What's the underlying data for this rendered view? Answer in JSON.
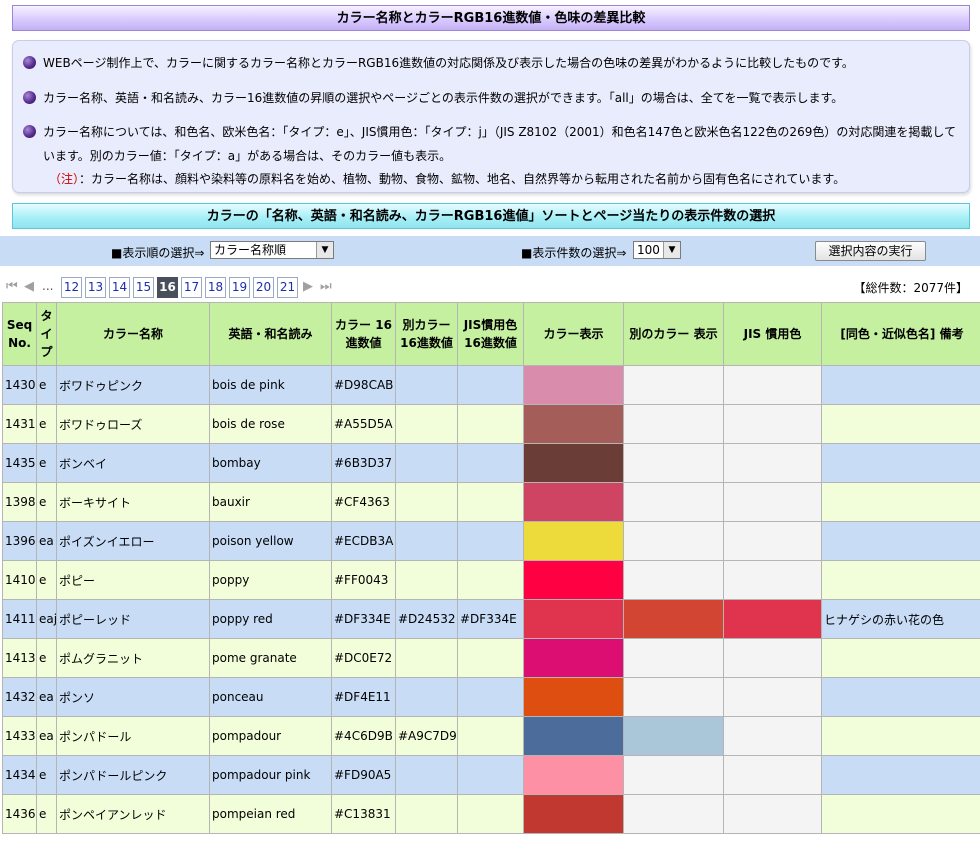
{
  "title": "カラー名称とカラーRGB16進数値・色味の差異比較",
  "info": {
    "line1": "WEBページ制作上で、カラーに関するカラー名称とカラーRGB16進数値の対応関係及び表示した場合の色味の差異がわかるように比較したものです。",
    "line2": "カラー名称、英語・和名読み、カラー16進数値の昇順の選択やページごとの表示件数の選択ができます。「all」の場合は、全てを一覧で表示します。",
    "line3a": "カラー名称については、和色名、欧米色名：「タイプ：e」、JIS慣用色：「タイプ：j」（JIS Z8102（2001）和色名147色と欧米色名122色の269色）の対応関連を掲載して",
    "line3b": "います。別のカラー値：「タイプ：a」がある場合は、そのカラー値も表示。",
    "note_mark": "（注）",
    "note_text": "：カラー名称は、顔料や染料等の原料名を始め、植物、動物、食物、鉱物、地名、自然界等から転用された名前から固有色名にされています。"
  },
  "subtitle": "カラーの「名称、英語・和名読み、カラーRGB16進値」ソートとページ当たりの表示件数の選択",
  "controls": {
    "order_label": "■表示順の選択⇒",
    "order_value": "カラー名称順",
    "count_label": "■表示件数の選択⇒",
    "count_value": "100",
    "exec_label": "選択内容の実行"
  },
  "pager": {
    "ellipsis": "...",
    "pages": [
      "12",
      "13",
      "14",
      "15",
      "16",
      "17",
      "18",
      "19",
      "20",
      "21"
    ],
    "current": "16",
    "total": "【総件数：2077件】"
  },
  "table": {
    "headers": {
      "seq": "Seq No.",
      "type": "タイプ",
      "name": "カラー名称",
      "reading": "英語・和名読み",
      "hex": "カラー 16進数値",
      "alt_hex": "別カラー 16進数値",
      "jis_hex": "JIS慣用色 16進数値",
      "display": "カラー表示",
      "alt_display": "別のカラー 表示",
      "jis_display": "JIS 慣用色",
      "note": "[同色・近似色名] 備考"
    },
    "rows": [
      {
        "seq": "1430",
        "type": "e",
        "name": "ボワドゥピンク",
        "reading": "bois de pink",
        "hex": "#D98CAB",
        "alt_hex": "",
        "jis_hex": "",
        "note": ""
      },
      {
        "seq": "1431",
        "type": "e",
        "name": "ボワドゥローズ",
        "reading": "bois de rose",
        "hex": "#A55D5A",
        "alt_hex": "",
        "jis_hex": "",
        "note": ""
      },
      {
        "seq": "1435",
        "type": "e",
        "name": "ボンベイ",
        "reading": "bombay",
        "hex": "#6B3D37",
        "alt_hex": "",
        "jis_hex": "",
        "note": ""
      },
      {
        "seq": "1398",
        "type": "e",
        "name": "ボーキサイト",
        "reading": "bauxir",
        "hex": "#CF4363",
        "alt_hex": "",
        "jis_hex": "",
        "note": ""
      },
      {
        "seq": "1396",
        "type": "ea",
        "name": "ポイズンイエロー",
        "reading": "poison yellow",
        "hex": "#ECDB3A",
        "alt_hex": "",
        "jis_hex": "",
        "note": ""
      },
      {
        "seq": "1410",
        "type": "e",
        "name": "ポピー",
        "reading": "poppy",
        "hex": "#FF0043",
        "alt_hex": "",
        "jis_hex": "",
        "note": ""
      },
      {
        "seq": "1411",
        "type": "eaj",
        "name": "ポピーレッド",
        "reading": "poppy red",
        "hex": "#DF334E",
        "alt_hex": "#D24532",
        "jis_hex": "#DF334E",
        "note": "ヒナゲシの赤い花の色"
      },
      {
        "seq": "1413",
        "type": "e",
        "name": "ポムグラニット",
        "reading": "pome granate",
        "hex": "#DC0E72",
        "alt_hex": "",
        "jis_hex": "",
        "note": ""
      },
      {
        "seq": "1432",
        "type": "ea",
        "name": "ポンソ",
        "reading": "ponceau",
        "hex": "#DF4E11",
        "alt_hex": "",
        "jis_hex": "",
        "note": ""
      },
      {
        "seq": "1433",
        "type": "ea",
        "name": "ポンパドール",
        "reading": "pompadour",
        "hex": "#4C6D9B",
        "alt_hex": "#A9C7D9",
        "jis_hex": "",
        "note": ""
      },
      {
        "seq": "1434",
        "type": "e",
        "name": "ポンパドールピンク",
        "reading": "pompadour pink",
        "hex": "#FD90A5",
        "alt_hex": "",
        "jis_hex": "",
        "note": ""
      },
      {
        "seq": "1436",
        "type": "e",
        "name": "ポンペイアンレッド",
        "reading": "pompeian red",
        "hex": "#C13831",
        "alt_hex": "",
        "jis_hex": "",
        "note": ""
      }
    ]
  }
}
